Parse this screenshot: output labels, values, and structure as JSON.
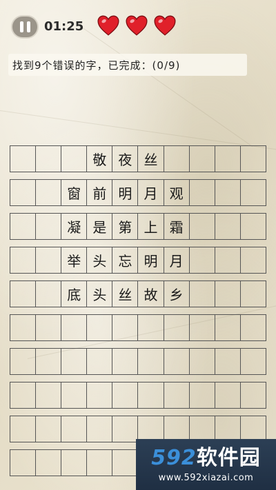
{
  "hud": {
    "timer": "01:25",
    "lives": 3,
    "heart_color": "#e0202a"
  },
  "instruction": "找到9个错误的字，已完成：(0/9)",
  "grid": {
    "columns": 10,
    "rows": [
      [
        "",
        "",
        "",
        "敬",
        "夜",
        "丝",
        "",
        "",
        "",
        ""
      ],
      [
        "",
        "",
        "窗",
        "前",
        "明",
        "月",
        "观",
        "",
        "",
        ""
      ],
      [
        "",
        "",
        "凝",
        "是",
        "第",
        "上",
        "霜",
        "",
        "",
        ""
      ],
      [
        "",
        "",
        "举",
        "头",
        "忘",
        "明",
        "月",
        "",
        "",
        ""
      ],
      [
        "",
        "",
        "底",
        "头",
        "丝",
        "故",
        "乡",
        "",
        "",
        ""
      ],
      [
        "",
        "",
        "",
        "",
        "",
        "",
        "",
        "",
        "",
        ""
      ],
      [
        "",
        "",
        "",
        "",
        "",
        "",
        "",
        "",
        "",
        ""
      ],
      [
        "",
        "",
        "",
        "",
        "",
        "",
        "",
        "",
        "",
        ""
      ],
      [
        "",
        "",
        "",
        "",
        "",
        "",
        "",
        "",
        "",
        ""
      ],
      [
        "",
        "",
        "",
        "",
        "",
        "",
        "",
        "",
        "",
        ""
      ]
    ]
  },
  "watermark": {
    "brand_num": "592",
    "brand_cn": "软件园",
    "url": "www.592xiazai.com"
  }
}
